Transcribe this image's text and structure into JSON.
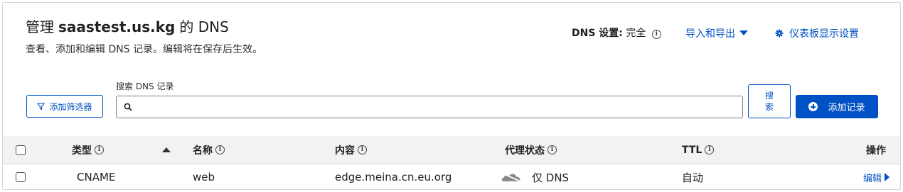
{
  "header": {
    "title_prefix": "管理",
    "domain": "saastest.us.kg",
    "title_suffix": "的 DNS",
    "subtitle": "查看、添加和编辑 DNS 记录。编辑将在保存后生效。"
  },
  "dns_settings": {
    "label": "DNS 设置:",
    "value": "完全"
  },
  "links": {
    "import_export": "导入和导出",
    "dashboard_display": "仪表板显示设置"
  },
  "filter": {
    "add_filter_label": "添加筛选器"
  },
  "search": {
    "label": "搜索 DNS 记录",
    "value": "",
    "placeholder": "",
    "button_label": "搜索"
  },
  "actions": {
    "add_record_label": "添加记录"
  },
  "table": {
    "columns": {
      "type": "类型",
      "name": "名称",
      "content": "内容",
      "proxy_status": "代理状态",
      "ttl": "TTL",
      "actions": "操作"
    },
    "rows": [
      {
        "type": "CNAME",
        "name": "web",
        "content": "edge.meina.cn.eu.org",
        "proxy_status": "仅 DNS",
        "ttl": "自动",
        "edit": "编辑"
      }
    ]
  },
  "colors": {
    "accent": "#0051c3",
    "header_bg": "#f2f2f2",
    "cloud": "#8a8a8a"
  },
  "icons": {
    "info": "info-icon",
    "caret": "caret-down-icon",
    "gear": "gear-icon",
    "filter": "filter-icon",
    "search": "search-icon",
    "plus": "plus-circle-icon",
    "sort": "sort-up-icon",
    "cloud": "cloud-icon",
    "edit_arrow": "chevron-right-icon"
  }
}
